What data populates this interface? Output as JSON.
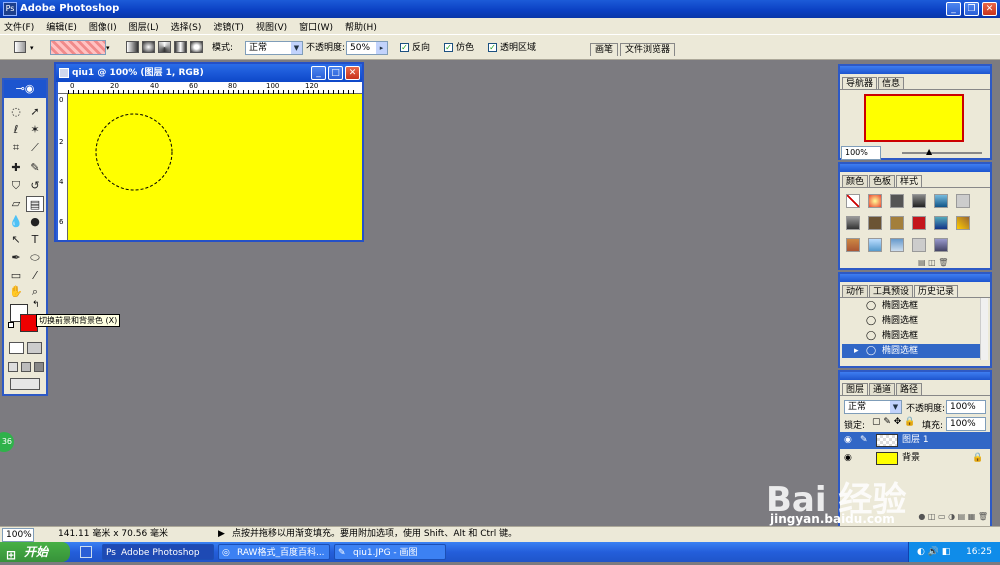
{
  "app": {
    "title": "Adobe Photoshop",
    "icon": "ps-logo-icon"
  },
  "window_controls": {
    "minimize": "_",
    "restore": "❐",
    "close": "✕"
  },
  "menu": [
    "文件(F)",
    "编辑(E)",
    "图像(I)",
    "图层(L)",
    "选择(S)",
    "滤镜(T)",
    "视图(V)",
    "窗口(W)",
    "帮助(H)"
  ],
  "options": {
    "mode_label": "模式:",
    "mode_value": "正常",
    "opacity_label": "不透明度:",
    "opacity_value": "50%",
    "reverse_label": "反向",
    "dither_label": "仿色",
    "transparency_label": "透明区域",
    "tab_brushes": "画笔",
    "tab_file_browser": "文件浏览器"
  },
  "document": {
    "title": "qiu1 @ 100% (图层 1, RGB)",
    "ruler_ticks": [
      "0",
      "20",
      "40",
      "60",
      "80",
      "100",
      "120"
    ],
    "ruler_left": [
      "0",
      "2",
      "4",
      "6"
    ],
    "canvas_color": "#ffff00"
  },
  "tooltip": "切换前景和背景色 (X)",
  "navigator": {
    "tabs": [
      "导航器",
      "信息"
    ],
    "zoom": "100%"
  },
  "swatches": {
    "tabs": [
      "颜色",
      "色板",
      "样式"
    ]
  },
  "history": {
    "tabs": [
      "动作",
      "工具预设",
      "历史记录"
    ],
    "items": [
      "椭圆选框",
      "椭圆选框",
      "椭圆选框",
      "椭圆选框"
    ]
  },
  "layers": {
    "tabs": [
      "图层",
      "通道",
      "路径"
    ],
    "blend": "正常",
    "opacity_label": "不透明度:",
    "opacity": "100%",
    "lock_label": "锁定:",
    "fill_label": "填充:",
    "fill": "100%",
    "items": [
      "图层 1",
      "背景"
    ]
  },
  "status": {
    "zoom": "100%",
    "size": "141.11 毫米 x 70.56 毫米",
    "hint": "点按并拖移以用渐变填充。要用附加选项，使用 Shift、Alt 和 Ctrl 键。"
  },
  "taskbar": {
    "start": "开始",
    "tasks": [
      "Adobe Photoshop",
      "RAW格式_百度百科...",
      "qiu1.JPG - 画图"
    ],
    "clock": "16:25"
  },
  "watermark": {
    "text": "Bai 经验",
    "url": "jingyan.baidu.com"
  },
  "side_badge": "36"
}
